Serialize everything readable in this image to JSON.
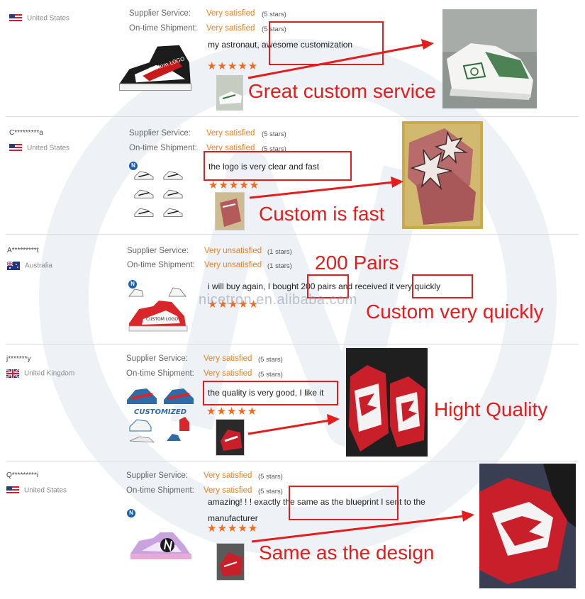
{
  "watermark": "nicetron.en.alibaba.com",
  "labels": {
    "supplier_service": "Supplier Service:",
    "shipment": "On-time Shipment:"
  },
  "reviews": [
    {
      "user": "",
      "country": "United States",
      "flag": "us",
      "supplier_value": "Very satisfied",
      "supplier_stars": "(5 stars)",
      "shipment_value": "Very satisfied",
      "shipment_stars": "(5 stars)",
      "comment": "my astronaut, awesome customization",
      "stars": "★★★★★",
      "caption": "Great custom service",
      "shoe_text": "Custom LOGO"
    },
    {
      "user": "C*********a",
      "country": "United States",
      "flag": "us",
      "supplier_value": "Very satisfied",
      "supplier_stars": "(5 stars)",
      "shipment_value": "Very satisfied",
      "shipment_stars": "(5 stars)",
      "comment": "the logo is very clear and fast",
      "stars": "★★★★★",
      "caption": "Custom is fast"
    },
    {
      "user": "A*********t",
      "country": "Australia",
      "flag": "au",
      "supplier_value": "Very unsatisfied",
      "supplier_stars": "(1 stars)",
      "shipment_value": "Very unsatisfied",
      "shipment_stars": "(1 stars)",
      "comment": "i will buy again, I bought 200 pairs and received it very quickly",
      "stars": "★★★★★",
      "caption_top": "200 Pairs",
      "caption": "Custom very quickly",
      "shoe_text": "CUSTOM LOGO"
    },
    {
      "user": "j*******y",
      "country": "United Kingdom",
      "flag": "uk",
      "supplier_value": "Very satisfied",
      "supplier_stars": "(5 stars)",
      "shipment_value": "Very satisfied",
      "shipment_stars": "(5 stars)",
      "comment": "the quality is very good, I like it",
      "stars": "★★★★★",
      "caption": "Hight Quality",
      "shoe_text": "CUSTOMIZED"
    },
    {
      "user": "Q*********i",
      "country": "United States",
      "flag": "us",
      "supplier_value": "Very satisfied",
      "supplier_stars": "(5 stars)",
      "shipment_value": "Very satisfied",
      "shipment_stars": "(5 stars)",
      "comment": "amazing! ! ! exactly the same as the blueprint I sent to the manufacturer",
      "stars": "★★★★★",
      "caption": "Same as the design"
    }
  ],
  "colors": {
    "accent_orange": "#f07f1c",
    "highlight_red": "#e51c1c"
  }
}
